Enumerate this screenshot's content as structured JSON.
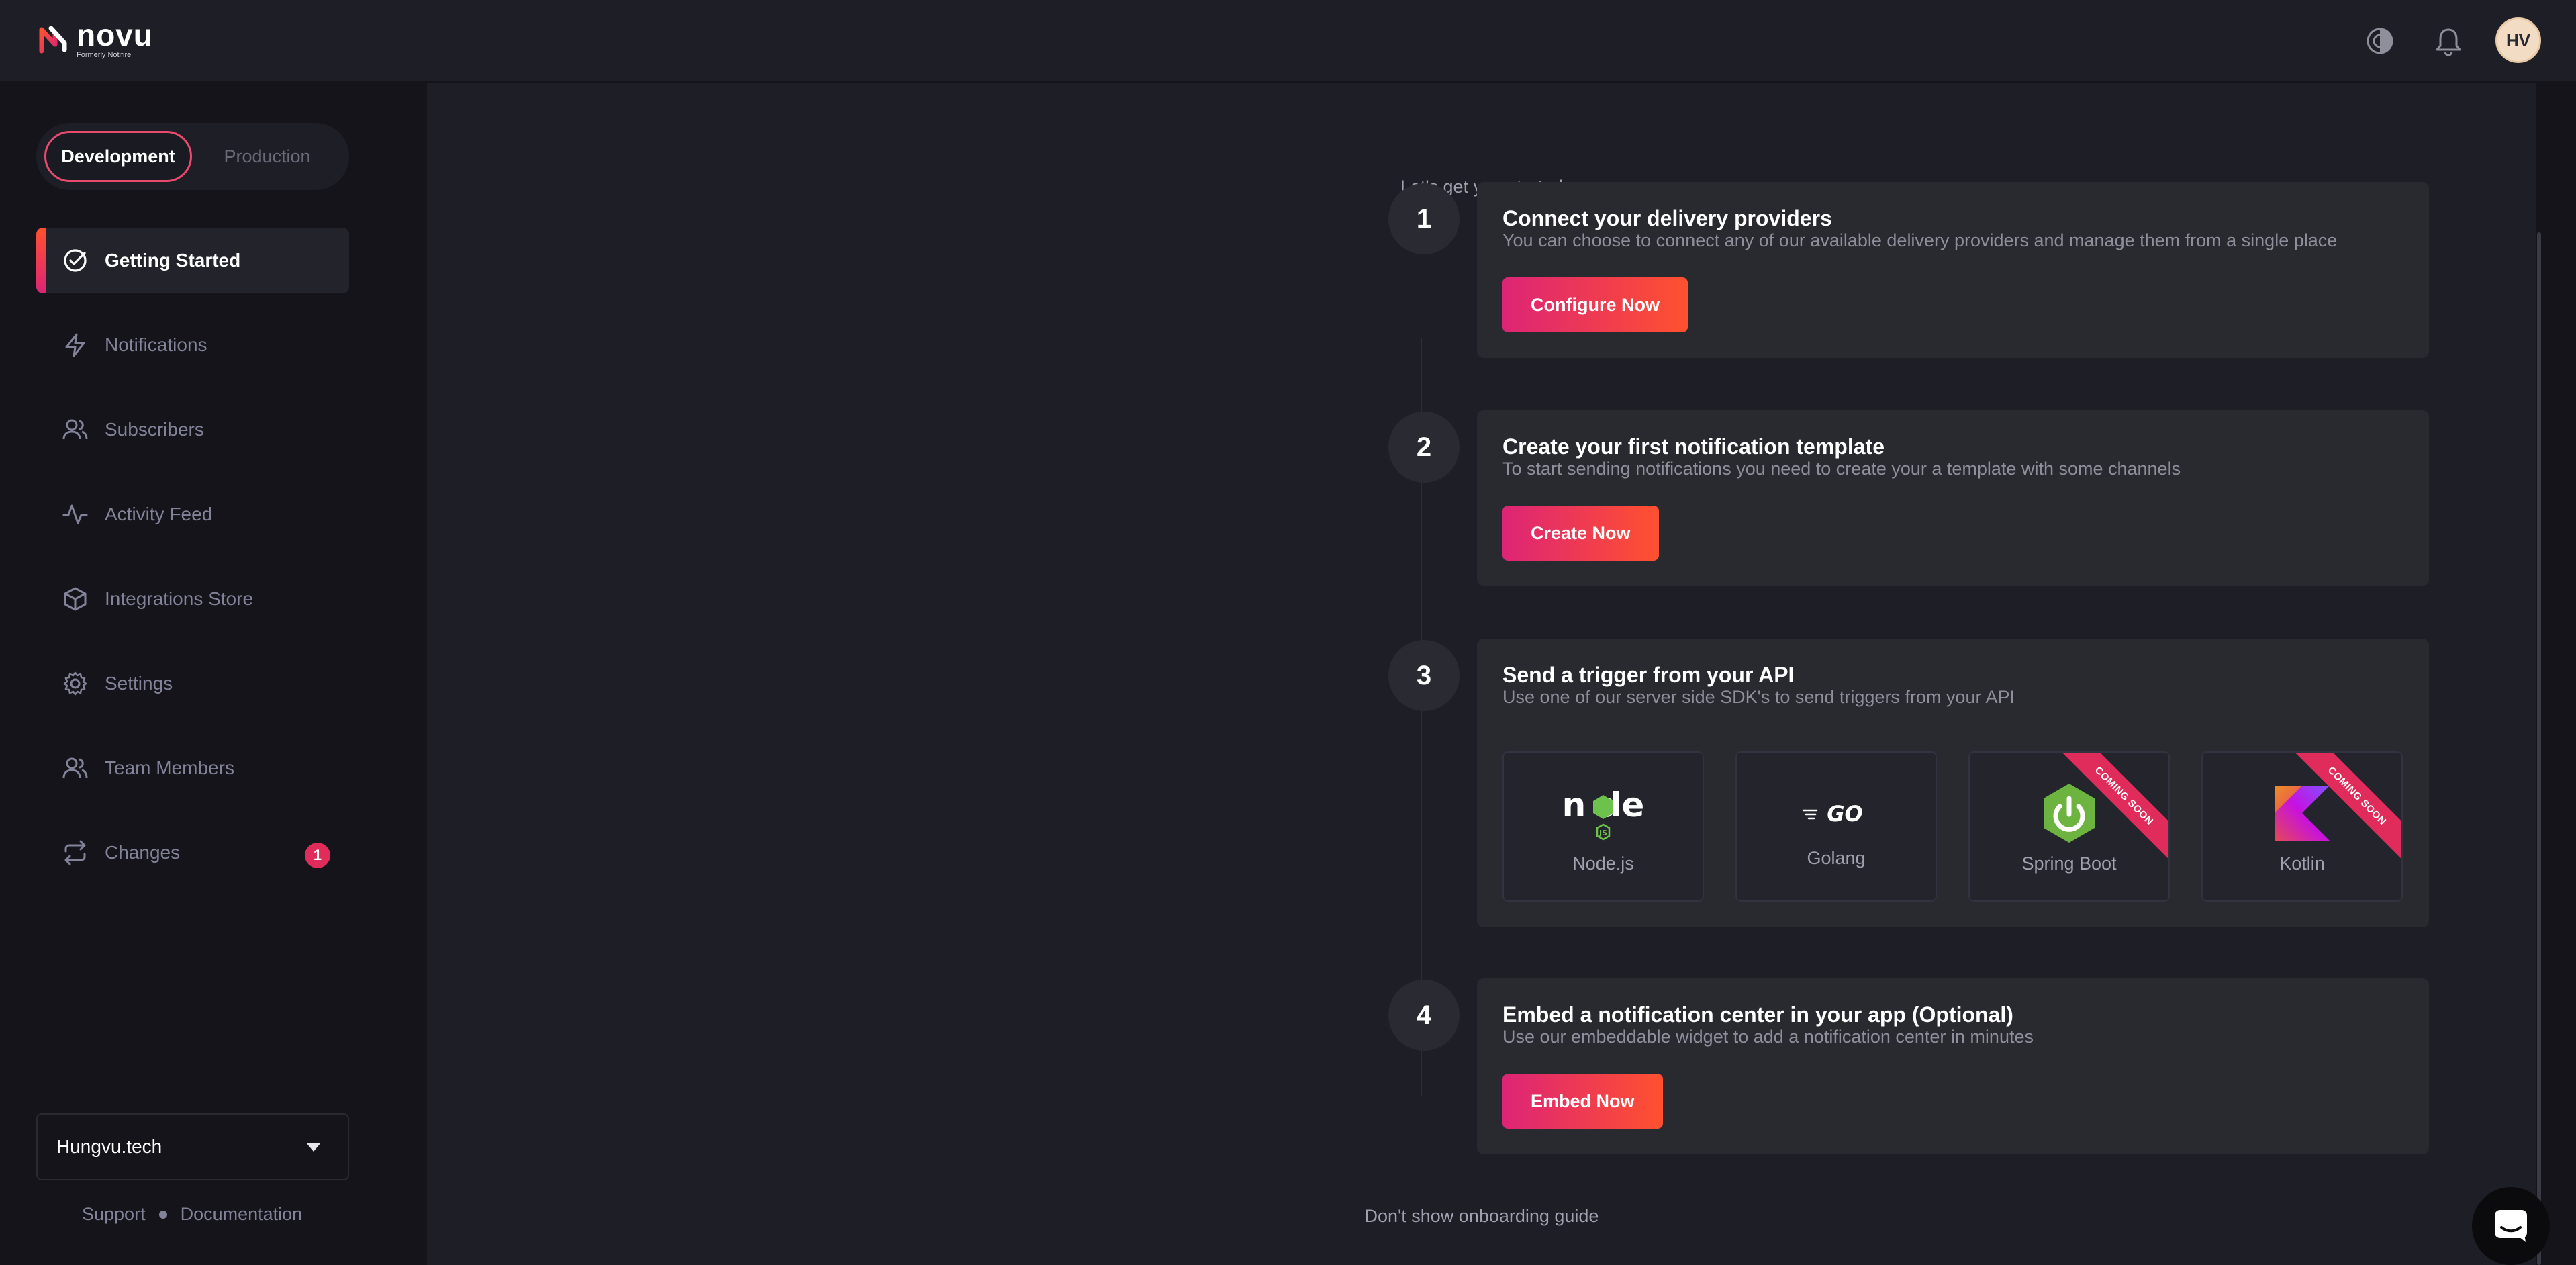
{
  "app": {
    "logo_name": "novu",
    "logo_sub": "Formerly Notifire",
    "avatar_initials": "HV",
    "accent": "#e02c5a"
  },
  "header": {
    "icons": [
      "theme-toggle-icon",
      "bell-icon"
    ]
  },
  "env": {
    "options": [
      "Development",
      "Production"
    ],
    "selected": "Development"
  },
  "sidebar": {
    "items": [
      {
        "label": "Getting Started",
        "icon": "check-circle-icon",
        "active": true
      },
      {
        "label": "Notifications",
        "icon": "bolt-icon"
      },
      {
        "label": "Subscribers",
        "icon": "users-icon"
      },
      {
        "label": "Activity Feed",
        "icon": "activity-icon"
      },
      {
        "label": "Integrations Store",
        "icon": "box-icon"
      },
      {
        "label": "Settings",
        "icon": "gear-icon"
      },
      {
        "label": "Team Members",
        "icon": "team-icon"
      },
      {
        "label": "Changes",
        "icon": "repeat-icon",
        "badge": "1"
      }
    ],
    "org": "Hungvu.tech",
    "footer": [
      "Support",
      "Documentation"
    ]
  },
  "main": {
    "intro": "Let's get you started",
    "steps": [
      {
        "num": "1",
        "title": "Connect your delivery providers",
        "desc": "You can choose to connect any of our available delivery providers and manage them from a single place",
        "cta": "Configure Now"
      },
      {
        "num": "2",
        "title": "Create your first notification template",
        "desc": "To start sending notifications you need to create your a template with some channels",
        "cta": "Create Now"
      },
      {
        "num": "3",
        "title": "Send a trigger from your API",
        "desc": "Use one of our server side SDK's to send triggers from your API",
        "sdks": [
          {
            "label": "Node.js",
            "logo_text": "node"
          },
          {
            "label": "Golang",
            "logo_text": "GO"
          },
          {
            "label": "Spring Boot",
            "ribbon": "COMING SOON"
          },
          {
            "label": "Kotlin",
            "ribbon": "COMING SOON"
          }
        ]
      },
      {
        "num": "4",
        "title": "Embed a notification center in your app (Optional)",
        "desc": "Use our embeddable widget to add a notification center in minutes",
        "cta": "Embed Now"
      }
    ],
    "dont_show": "Don't show onboarding guide"
  }
}
